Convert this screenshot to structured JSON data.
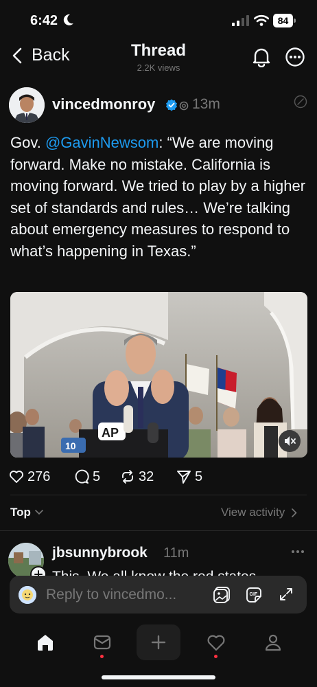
{
  "status_bar": {
    "time": "6:42",
    "battery": "84"
  },
  "header": {
    "back_label": "Back",
    "title": "Thread",
    "views": "2.2K views"
  },
  "post": {
    "username": "vincedmonroy",
    "time_ago": "13m",
    "text_prefix": "Gov. ",
    "mention": "@GavinNewsom",
    "text_body": ": “We are moving forward. Make no mistake. California is moving forward. We tried to play by a higher set of standards and rules… We’re talking about emergency measures to respond to what’s happening in Texas.”",
    "media": {
      "mic_label": "AP",
      "tag_label": "10"
    }
  },
  "actions": {
    "likes": "276",
    "comments": "5",
    "reposts": "32",
    "shares": "5"
  },
  "sort": {
    "label": "Top",
    "view_activity": "View activity"
  },
  "reply": {
    "username": "jbsunnybrook",
    "time_ago": "11m",
    "text": "This. We all know the red states"
  },
  "composer": {
    "placeholder": "Reply to vincedmo..."
  },
  "colors": {
    "background": "#101010",
    "accent": "#1d9bf0",
    "notification": "#ff3040",
    "muted": "#777777"
  }
}
